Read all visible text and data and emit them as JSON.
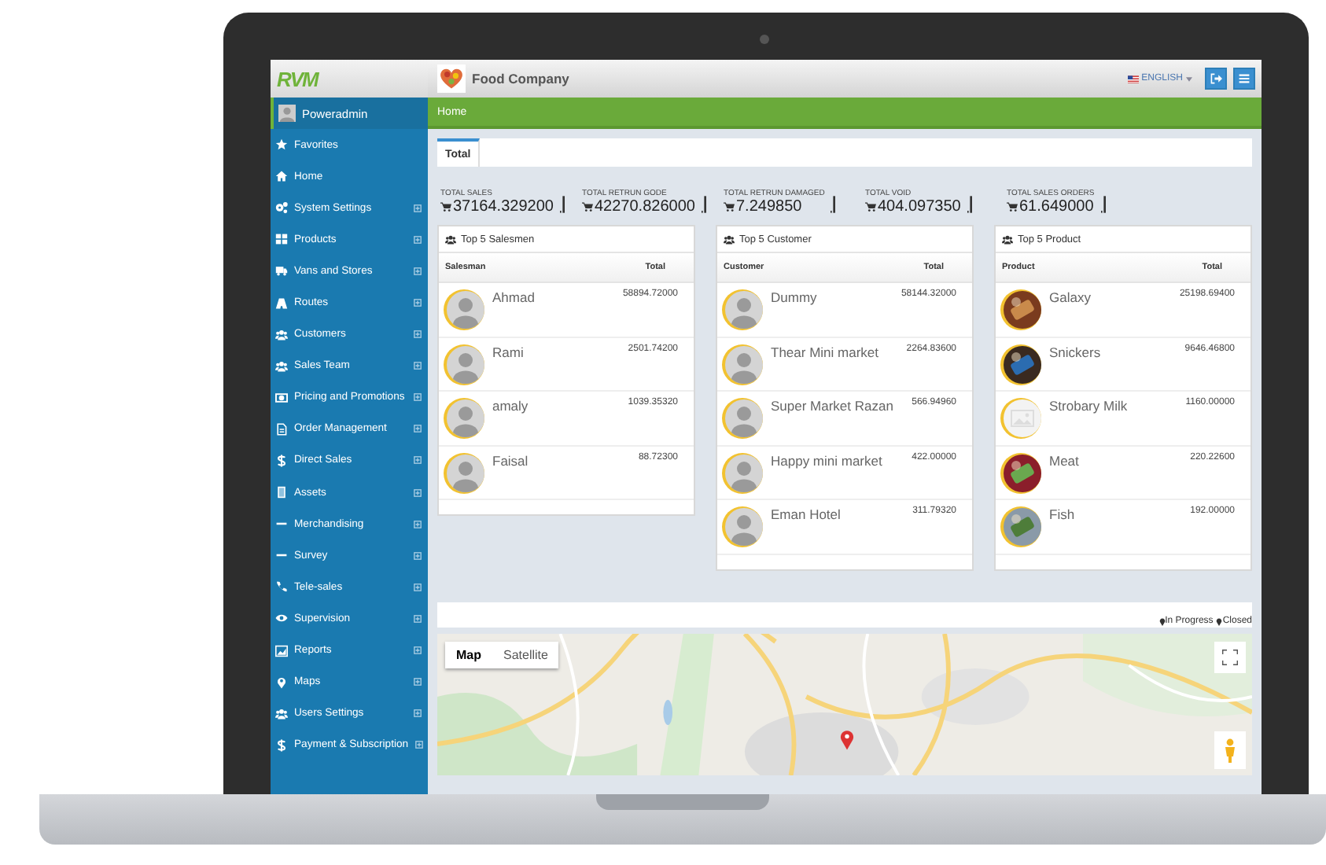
{
  "sidebar": {
    "logo": "RVM",
    "user": "Poweradmin",
    "items": [
      {
        "label": "Favorites",
        "expandable": false
      },
      {
        "label": "Home",
        "expandable": false
      },
      {
        "label": "System Settings",
        "expandable": true
      },
      {
        "label": "Products",
        "expandable": true
      },
      {
        "label": "Vans and Stores",
        "expandable": true
      },
      {
        "label": "Routes",
        "expandable": true
      },
      {
        "label": "Customers",
        "expandable": true
      },
      {
        "label": "Sales Team",
        "expandable": true
      },
      {
        "label": "Pricing and Promotions",
        "expandable": true
      },
      {
        "label": "Order Management",
        "expandable": true
      },
      {
        "label": "Direct Sales",
        "expandable": true
      },
      {
        "label": "Assets",
        "expandable": true
      },
      {
        "label": "Merchandising",
        "expandable": true
      },
      {
        "label": "Survey",
        "expandable": true
      },
      {
        "label": "Tele-sales",
        "expandable": true
      },
      {
        "label": "Supervision",
        "expandable": true
      },
      {
        "label": "Reports",
        "expandable": true
      },
      {
        "label": "Maps",
        "expandable": true
      },
      {
        "label": "Users Settings",
        "expandable": true
      },
      {
        "label": "Payment & Subscription",
        "expandable": true
      }
    ]
  },
  "header": {
    "company": "Food Company",
    "language": "ENGLISH"
  },
  "breadcrumb": "Home",
  "tabs": [
    {
      "label": "Total",
      "selected": true
    }
  ],
  "stats": [
    {
      "label": "TOTAL SALES",
      "value": "37164.329200"
    },
    {
      "label": "TOTAL RETRUN GODE",
      "value": "42270.826000"
    },
    {
      "label": "TOTAL RETRUN DAMAGED",
      "value": "7.249850"
    },
    {
      "label": "TOTAL VOID",
      "value": "404.097350"
    },
    {
      "label": "TOTAL SALES ORDERS",
      "value": "61.649000"
    }
  ],
  "panels": [
    {
      "title": "Top 5 Salesmen",
      "columns": [
        "Salesman",
        "Total"
      ],
      "rows": [
        {
          "name": "Ahmad",
          "total": "58894.72000",
          "kind": "person"
        },
        {
          "name": "Rami",
          "total": "2501.74200",
          "kind": "person"
        },
        {
          "name": "amaly",
          "total": "1039.35320",
          "kind": "person"
        },
        {
          "name": "Faisal",
          "total": "88.72300",
          "kind": "person"
        }
      ]
    },
    {
      "title": "Top 5 Customer",
      "columns": [
        "Customer",
        "Total"
      ],
      "rows": [
        {
          "name": "Dummy",
          "total": "58144.32000",
          "kind": "person"
        },
        {
          "name": "Thear Mini market",
          "total": "2264.83600",
          "kind": "person"
        },
        {
          "name": "Super Market Razan",
          "total": "566.94960",
          "kind": "person"
        },
        {
          "name": "Happy mini market",
          "total": "422.00000",
          "kind": "person"
        },
        {
          "name": "Eman Hotel",
          "total": "311.79320",
          "kind": "person"
        }
      ]
    },
    {
      "title": "Top 5 Product",
      "columns": [
        "Product",
        "Total"
      ],
      "rows": [
        {
          "name": "Galaxy",
          "total": "25198.69400",
          "kind": "picture"
        },
        {
          "name": "Snickers",
          "total": "9646.46800",
          "kind": "picture"
        },
        {
          "name": "Strobary Milk",
          "total": "1160.00000",
          "kind": "placeholder"
        },
        {
          "name": "Meat",
          "total": "220.22600",
          "kind": "picture"
        },
        {
          "name": "Fish",
          "total": "192.00000",
          "kind": "picture"
        }
      ]
    }
  ],
  "legend": [
    "In Progress",
    "Closed"
  ],
  "map": {
    "types": [
      {
        "label": "Map",
        "selected": true
      },
      {
        "label": "Satellite",
        "selected": false
      }
    ]
  }
}
